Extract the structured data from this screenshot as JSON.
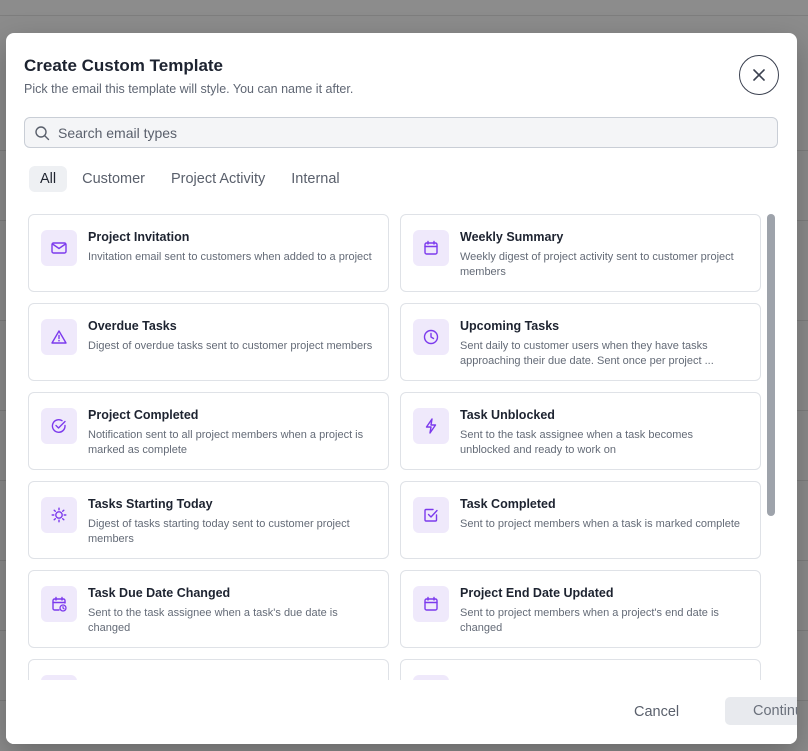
{
  "modal": {
    "title": "Create Custom Template",
    "subtitle": "Pick the email this template will style. You can name it after."
  },
  "search": {
    "placeholder": "Search email types"
  },
  "tabs": [
    {
      "label": "All",
      "active": true
    },
    {
      "label": "Customer",
      "active": false
    },
    {
      "label": "Project Activity",
      "active": false
    },
    {
      "label": "Internal",
      "active": false
    }
  ],
  "templates": [
    {
      "icon": "mail-icon",
      "title": "Project Invitation",
      "description": "Invitation email sent to customers when added to a project"
    },
    {
      "icon": "calendar-icon",
      "title": "Weekly Summary",
      "description": "Weekly digest of project activity sent to customer project members"
    },
    {
      "icon": "warning-icon",
      "title": "Overdue Tasks",
      "description": "Digest of overdue tasks sent to customer project members"
    },
    {
      "icon": "clock-icon",
      "title": "Upcoming Tasks",
      "description": "Sent daily to customer users when they have tasks approaching their due date. Sent once per project ..."
    },
    {
      "icon": "check-circle-icon",
      "title": "Project Completed",
      "description": "Notification sent to all project members when a project is marked as complete"
    },
    {
      "icon": "lightning-icon",
      "title": "Task Unblocked",
      "description": "Sent to the task assignee when a task becomes unblocked and ready to work on"
    },
    {
      "icon": "sun-icon",
      "title": "Tasks Starting Today",
      "description": "Digest of tasks starting today sent to customer project members"
    },
    {
      "icon": "check-square-icon",
      "title": "Task Completed",
      "description": "Sent to project members when a task is marked complete"
    },
    {
      "icon": "calendar-clock-icon",
      "title": "Task Due Date Changed",
      "description": "Sent to the task assignee when a task's due date is changed"
    },
    {
      "icon": "calendar-icon",
      "title": "Project End Date Updated",
      "description": "Sent to project members when a project's end date is changed"
    },
    {
      "icon": "calendar-icon",
      "title": "",
      "description": ""
    },
    {
      "icon": "calendar-icon",
      "title": "",
      "description": ""
    }
  ],
  "footer": {
    "cancel_label": "Cancel",
    "continue_label": "Continue"
  },
  "colors": {
    "accent": "#7c3aed",
    "icon_bg": "#efe9fb",
    "overlay": "#8a8a8a"
  }
}
